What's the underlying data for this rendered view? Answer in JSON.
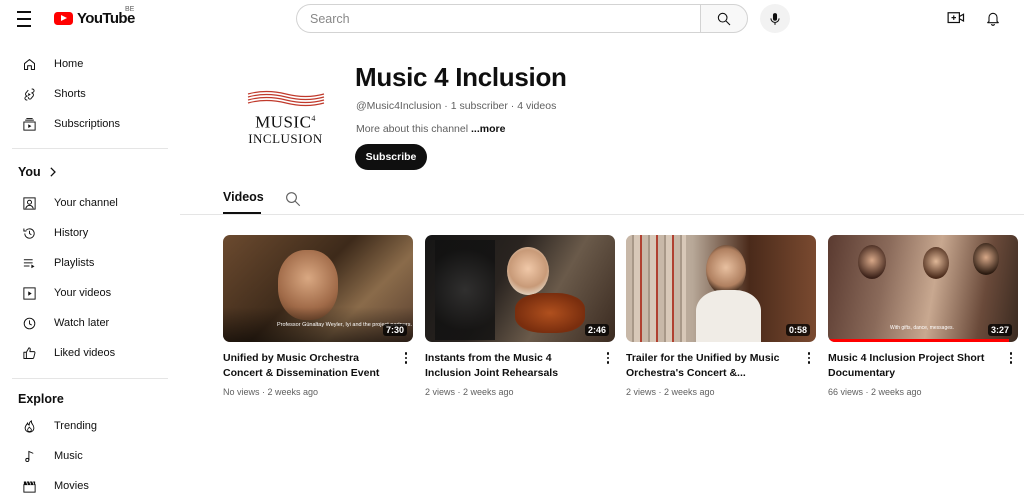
{
  "header": {
    "logo_text": "YouTube",
    "country_code": "BE",
    "search_placeholder": "Search"
  },
  "sidebar": {
    "main": [
      {
        "label": "Home",
        "icon": "home-icon"
      },
      {
        "label": "Shorts",
        "icon": "shorts-icon"
      },
      {
        "label": "Subscriptions",
        "icon": "subscriptions-icon"
      }
    ],
    "you_heading": "You",
    "you": [
      {
        "label": "Your channel",
        "icon": "your-channel-icon"
      },
      {
        "label": "History",
        "icon": "history-icon"
      },
      {
        "label": "Playlists",
        "icon": "playlists-icon"
      },
      {
        "label": "Your videos",
        "icon": "your-videos-icon"
      },
      {
        "label": "Watch later",
        "icon": "watch-later-icon"
      },
      {
        "label": "Liked videos",
        "icon": "liked-videos-icon"
      }
    ],
    "explore_heading": "Explore",
    "explore": [
      {
        "label": "Trending",
        "icon": "trending-icon"
      },
      {
        "label": "Music",
        "icon": "music-icon"
      },
      {
        "label": "Movies",
        "icon": "movies-icon"
      }
    ]
  },
  "channel": {
    "title": "Music 4 Inclusion",
    "handle_meta": "@Music4Inclusion · 1 subscriber · 4 videos",
    "about_text": "More about this channel",
    "about_more": " ...more",
    "subscribe_label": "Subscribe",
    "logo_line1": "MUSIC",
    "logo_sup": "4",
    "logo_line2": "INCLUSION"
  },
  "tabs": {
    "videos_label": "Videos"
  },
  "videos": [
    {
      "title": "Unified by Music Orchestra Concert & Dissemination Event",
      "meta": "No views · 2 weeks ago",
      "duration": "7:30",
      "caption": "Professor Günaltay Weyler, Iyi and the project partners."
    },
    {
      "title": "Instants from the Music 4 Inclusion Joint Rehearsals",
      "meta": "2 views · 2 weeks ago",
      "duration": "2:46"
    },
    {
      "title": "Trailer for the Unified by Music Orchestra's Concert &...",
      "meta": "2 views · 2 weeks ago",
      "duration": "0:58"
    },
    {
      "title": "Music 4 Inclusion Project Short Documentary",
      "meta": "66 views · 2 weeks ago",
      "duration": "3:27",
      "caption": "With gifts, dance, messages.",
      "watched_fraction": 0.95
    }
  ],
  "colors": {
    "brand_red": "#ff0000",
    "text_primary": "#0f0f0f",
    "text_secondary": "#606060"
  }
}
